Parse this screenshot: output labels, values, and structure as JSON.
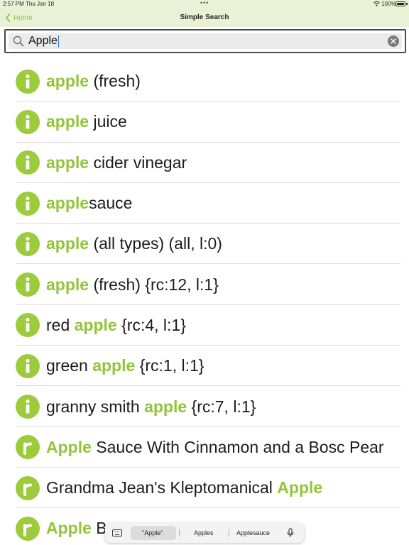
{
  "status_bar": {
    "time": "2:57 PM",
    "date": "Thu Jan 18",
    "battery": "100%"
  },
  "nav": {
    "back_label": "Home",
    "title": "Simple Search"
  },
  "search": {
    "value": "Apple",
    "placeholder": ""
  },
  "results": [
    {
      "badge": "i",
      "parts": [
        {
          "t": "apple",
          "hl": true
        },
        {
          "t": " (fresh)",
          "hl": false
        }
      ]
    },
    {
      "badge": "i",
      "parts": [
        {
          "t": "apple",
          "hl": true
        },
        {
          "t": " juice",
          "hl": false
        }
      ]
    },
    {
      "badge": "i",
      "parts": [
        {
          "t": "apple",
          "hl": true
        },
        {
          "t": " cider vinegar",
          "hl": false
        }
      ]
    },
    {
      "badge": "i",
      "parts": [
        {
          "t": "apple",
          "hl": true
        },
        {
          "t": "sauce",
          "hl": false
        }
      ]
    },
    {
      "badge": "i",
      "parts": [
        {
          "t": "apple",
          "hl": true
        },
        {
          "t": " (all types) (all, l:0)",
          "hl": false
        }
      ]
    },
    {
      "badge": "i",
      "parts": [
        {
          "t": "apple",
          "hl": true
        },
        {
          "t": " (fresh) {rc:12, l:1}",
          "hl": false
        }
      ]
    },
    {
      "badge": "i",
      "parts": [
        {
          "t": "red ",
          "hl": false
        },
        {
          "t": "apple",
          "hl": true
        },
        {
          "t": " {rc:4, l:1}",
          "hl": false
        }
      ]
    },
    {
      "badge": "i",
      "parts": [
        {
          "t": "green ",
          "hl": false
        },
        {
          "t": "apple",
          "hl": true
        },
        {
          "t": " {rc:1, l:1}",
          "hl": false
        }
      ]
    },
    {
      "badge": "i",
      "parts": [
        {
          "t": "granny smith ",
          "hl": false
        },
        {
          "t": "apple",
          "hl": true
        },
        {
          "t": " {rc:7, l:1}",
          "hl": false
        }
      ]
    },
    {
      "badge": "r",
      "parts": [
        {
          "t": "Apple",
          "hl": true
        },
        {
          "t": " Sauce With Cinnamon and a Bosc Pear",
          "hl": false
        }
      ]
    },
    {
      "badge": "r",
      "parts": [
        {
          "t": "Grandma Jean's Kleptomanical ",
          "hl": false
        },
        {
          "t": "Apple",
          "hl": true
        }
      ]
    },
    {
      "badge": "r",
      "parts": [
        {
          "t": "Apple",
          "hl": true
        },
        {
          "t": " B",
          "hl": false
        }
      ]
    }
  ],
  "suggestions": {
    "items": [
      "\"Apple\"",
      "Apples",
      "Applesauce"
    ]
  },
  "colors": {
    "accent": "#93c43a",
    "badge": "#9ccb3b",
    "nav_bg": "#e9f2d6"
  },
  "icons": {
    "info": "info-icon",
    "recipe": "recipe-icon",
    "search": "search-icon",
    "clear": "clear-icon",
    "back": "chevron-left-icon",
    "keyboard": "keyboard-icon",
    "mic": "microphone-icon"
  }
}
